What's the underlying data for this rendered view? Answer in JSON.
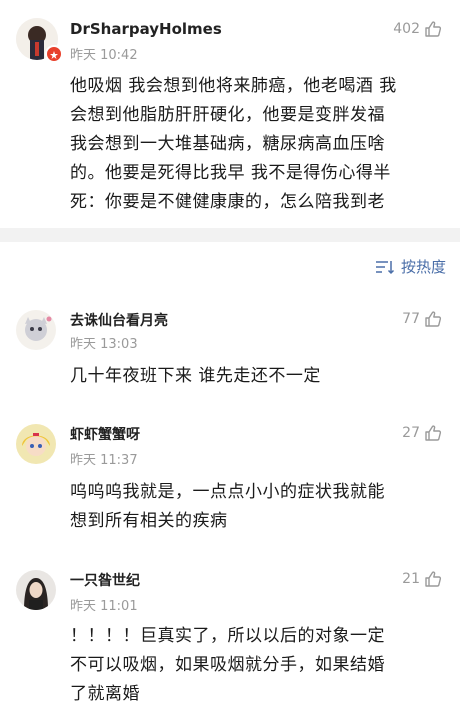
{
  "main_comment": {
    "username": "DrSharpayHolmes",
    "timestamp": "昨天 10:42",
    "likes": "402",
    "lines": [
      "他吸烟 我会想到他将来肺癌，他老喝酒 我",
      "会想到他脂肪肝肝硬化，他要是变胖发福",
      "我会想到一大堆基础病，糖尿病高血压啥",
      "的。他要是死得比我早 我不是得伤心得半",
      "死：你要是不健健康康的，怎么陪我到老"
    ]
  },
  "sort": {
    "label": "按热度"
  },
  "replies": [
    {
      "username": "去诛仙台看月亮",
      "timestamp": "昨天 13:03",
      "likes": "77",
      "lines": [
        "几十年夜班下来  谁先走还不一定"
      ]
    },
    {
      "username": "虾虾蟹蟹呀",
      "timestamp": "昨天 11:37",
      "likes": "27",
      "lines": [
        "呜呜呜我就是，一点点小小的症状我就能",
        "想到所有相关的疾病"
      ]
    },
    {
      "username": "一只昝世纪",
      "timestamp": "昨天 11:01",
      "likes": "21",
      "lines": [
        "！！！！巨真实了，所以以后的对象一定",
        "不可以吸烟，如果吸烟就分手，如果结婚",
        "了就离婚"
      ]
    }
  ],
  "colors": {
    "link_blue": "#4a6ea8",
    "meta_gray": "#9a9a9a",
    "separator": "#f2f2f2",
    "badge_red": "#e8412c"
  }
}
